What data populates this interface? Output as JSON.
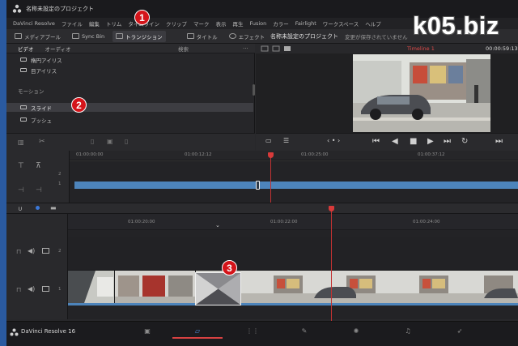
{
  "window": {
    "title": "名称未設定のプロジェクト"
  },
  "menu": [
    "DaVinci Resolve",
    "ファイル",
    "編集",
    "トリム",
    "タイムライン",
    "クリップ",
    "マーク",
    "表示",
    "再生",
    "Fusion",
    "カラー",
    "Fairlight",
    "ワークスペース",
    "ヘルプ"
  ],
  "toolbar": {
    "media_pool": "メディアプール",
    "sync_bin": "Sync Bin",
    "transitions": "トランジション",
    "titles": "タイトル",
    "effects": "エフェクト",
    "project_title": "名称未設定のプロジェクト",
    "saved_status": "変更が保存されていません"
  },
  "effects_panel": {
    "tabs": [
      "ビデオ",
      "オーディオ"
    ],
    "search_label": "検索",
    "items_top": [
      "楕円アイリス",
      "目アイリス"
    ],
    "section": "モーション",
    "items_motion": [
      "スライド",
      "プッシュ"
    ]
  },
  "viewer": {
    "timeline_name": "Timeline 1",
    "timecode": "00:00:59:13"
  },
  "mini_timeline": {
    "timecodes": [
      "01:00:00:00",
      "01:00:12:12",
      "01:00:25:00",
      "01:00:37:12"
    ],
    "tracks": [
      "2",
      "1"
    ]
  },
  "main_timeline": {
    "timecodes": [
      "01:00:20:00",
      "01:00:22:00",
      "01:00:24:00"
    ],
    "tracks": [
      "2",
      "1"
    ]
  },
  "pagebar": {
    "brand": "DaVinci Resolve 16"
  },
  "callouts": [
    "1",
    "2",
    "3"
  ],
  "watermark": "k05.biz",
  "colors": {
    "accent_red": "#d84242",
    "clip_blue": "#4d84bb",
    "callout_red": "#d4141a"
  }
}
